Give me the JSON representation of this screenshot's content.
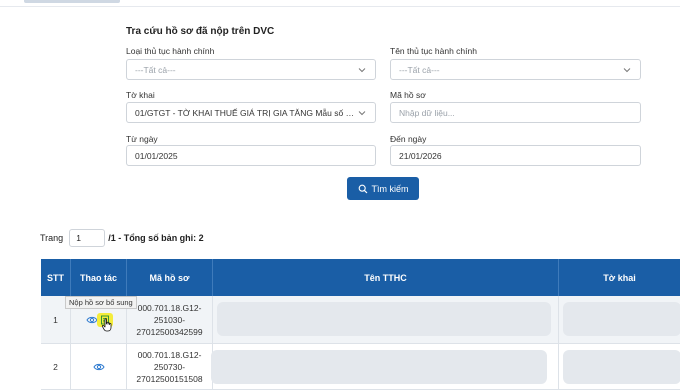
{
  "form": {
    "title": "Tra cứu hồ sơ đã nộp trên DVC",
    "procedure_type": {
      "label": "Loại thủ tục hành chính",
      "value": "---Tất cả---"
    },
    "procedure_name": {
      "label": "Tên thủ tục hành chính",
      "value": "---Tất cả---"
    },
    "declaration": {
      "label": "Tờ khai",
      "value": "01/GTGT - TỜ KHAI THUẾ GIÁ TRỊ GIA TĂNG Mẫu số 01/..."
    },
    "record_code": {
      "label": "Mã hồ sơ",
      "placeholder": "Nhập dữ liệu..."
    },
    "from_date": {
      "label": "Từ ngày",
      "value": "01/01/2025"
    },
    "to_date": {
      "label": "Đến ngày",
      "value": "21/01/2026"
    },
    "search_label": "Tìm kiếm"
  },
  "pager": {
    "page_label": "Trang",
    "page_value": "1",
    "total_text": "/1 - Tổng số bản ghi: 2"
  },
  "table": {
    "headers": {
      "stt": "STT",
      "actions": "Thao tác",
      "code": "Mã hồ sơ",
      "name": "Tên TTHC",
      "form": "Tờ khai"
    },
    "rows": [
      {
        "stt": "1",
        "code_l1": "000.701.18.G12-",
        "code_l2": "251030-",
        "code_l3": "27012500342599"
      },
      {
        "stt": "2",
        "code_l1": "000.701.18.G12-",
        "code_l2": "250730-",
        "code_l3": "27012500151508"
      }
    ]
  },
  "tooltip": "Nộp hồ sơ bổ sung",
  "colors": {
    "primary": "#1a5ea6",
    "row_alt": "#f1f4f7",
    "highlight": "#f4ec3c"
  },
  "icons": [
    "chevron-down-icon",
    "search-icon",
    "eye-icon",
    "document-edit-icon",
    "hand-cursor-icon"
  ]
}
